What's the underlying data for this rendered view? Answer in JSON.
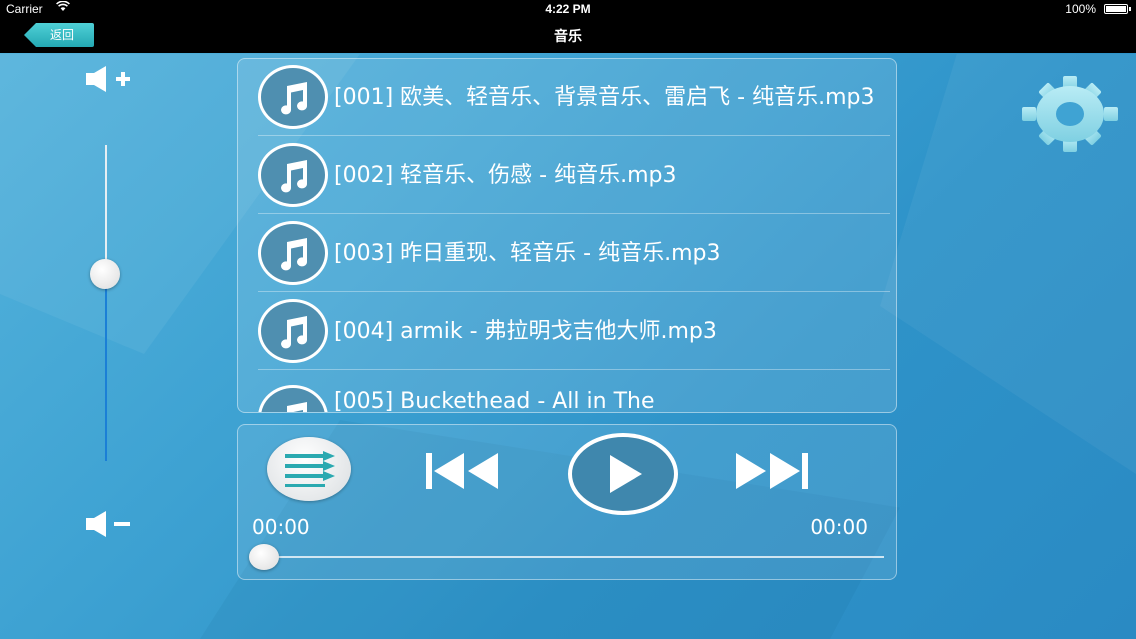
{
  "status_bar": {
    "carrier": "Carrier",
    "wifi_icon": "wifi-icon",
    "time": "4:22 PM",
    "battery": "100%",
    "battery_level": 1.0
  },
  "nav": {
    "back_label": "返回",
    "title": "音乐"
  },
  "volume": {
    "up_icon": "volume-up-icon",
    "down_icon": "volume-down-icon",
    "level": 0.6
  },
  "playlist": {
    "tracks": [
      {
        "title": "[001] 欧美、轻音乐、背景音乐、雷启飞 - 纯音乐.mp3"
      },
      {
        "title": "[002] 轻音乐、伤感 - 纯音乐.mp3"
      },
      {
        "title": "[003] 昨日重现、轻音乐 - 纯音乐.mp3"
      },
      {
        "title": "[004] armik - 弗拉明戈吉他大师.mp3"
      },
      {
        "title": "[005] Buckethead - All in The"
      }
    ]
  },
  "settings_icon": "gear-icon",
  "player": {
    "current_time": "00:00",
    "total_time": "00:00",
    "progress": 0.0,
    "colors": {
      "accent": "#3f87ad",
      "teal": "#24a8b3"
    }
  }
}
